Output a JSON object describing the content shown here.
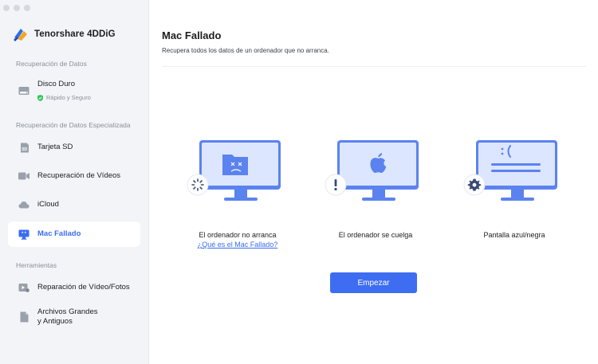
{
  "app": {
    "name": "Tenorshare 4DDiG"
  },
  "sidebar": {
    "sections": [
      {
        "title": "Recuperación de Datos"
      },
      {
        "title": "Recuperación de Datos Especializada"
      },
      {
        "title": "Herramientas"
      }
    ],
    "disk": {
      "label": "Disco Duro",
      "sub": "Rápido y Seguro"
    },
    "items": [
      {
        "label": "Tarjeta SD"
      },
      {
        "label": "Recuperación de Vídeos"
      },
      {
        "label": "iCloud"
      },
      {
        "label": "Mac Fallado"
      },
      {
        "label": "Reparación de Vídeo/Fotos"
      },
      {
        "label": "Archivos Grandes"
      },
      {
        "label": "y Antiguos"
      }
    ],
    "sd_badge": "SD"
  },
  "main": {
    "title": "Mac Fallado",
    "subtitle": "Recupera todos los datos de un ordenador que no arranca.",
    "cards": [
      {
        "label": "El ordenador no arranca",
        "link": "¿Qué es el Mac Fallado?"
      },
      {
        "label": "El ordenador se cuelga"
      },
      {
        "label": "Pantalla azul/negra"
      }
    ],
    "start_button": "Empezar"
  },
  "colors": {
    "accent": "#3f6df2",
    "sidebar_bg": "#f2f4f8",
    "monitor_blue": "#5b83f0",
    "shield_green": "#34c759"
  }
}
